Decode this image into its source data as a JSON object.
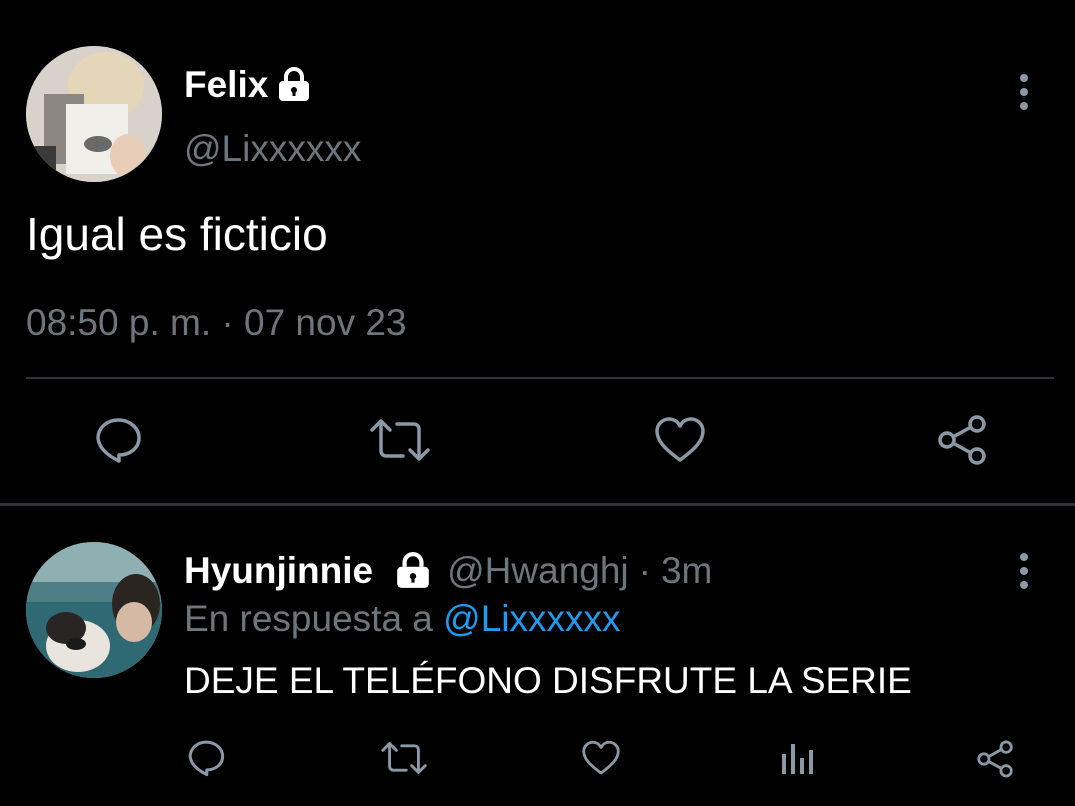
{
  "main_tweet": {
    "author_name": "Felix",
    "author_handle": "@Lixxxxxx",
    "text": "Igual es ficticio",
    "timestamp": "08:50 p. m. · 07 nov 23",
    "avatar_icon": "avatar-photo",
    "protected_icon": "lock-icon",
    "actions": [
      "reply-icon",
      "retweet-icon",
      "like-icon",
      "share-icon"
    ]
  },
  "reply": {
    "author_name": "Hyunjinnie",
    "author_handle": "@Hwanghj",
    "separator": "·",
    "time_ago": "3m",
    "reply_prefix": "En respuesta a",
    "reply_mention": "@Lixxxxxx",
    "text": "DEJE EL TELÉFONO DISFRUTE LA SERIE",
    "actions": [
      "reply-icon",
      "retweet-icon",
      "like-icon",
      "analytics-icon",
      "share-icon"
    ]
  },
  "colors": {
    "background": "#000000",
    "text": "#ffffff",
    "muted": "#6e767d",
    "mention": "#1d9bf0",
    "divider": "#2f3336",
    "icon": "#8b98a5"
  }
}
